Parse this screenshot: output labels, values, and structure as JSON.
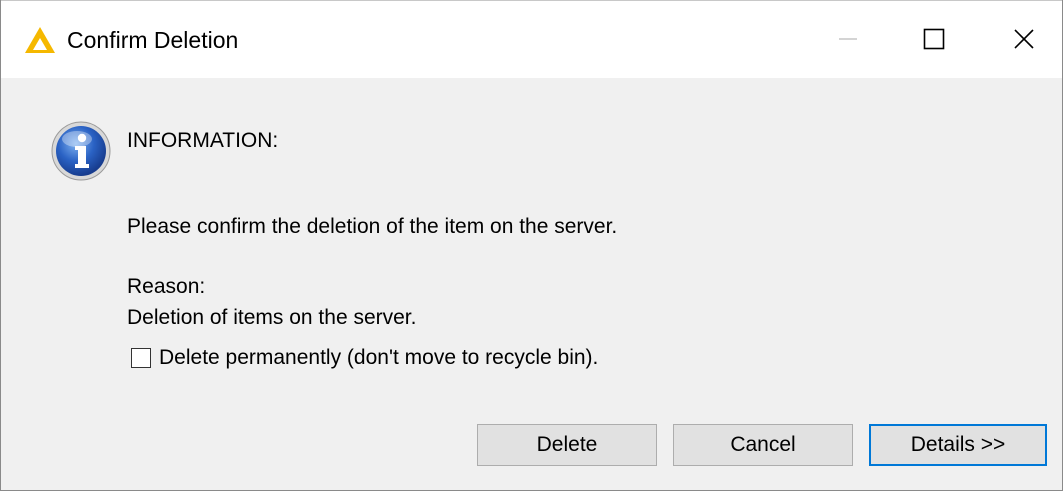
{
  "window": {
    "title": "Confirm Deletion",
    "app_icon": "triangle-logo-icon",
    "accent_color": "#f5b800",
    "controls": {
      "minimize": "minimize-icon",
      "maximize": "maximize-icon",
      "close": "close-icon"
    }
  },
  "dialog": {
    "icon": "information-icon",
    "heading": "INFORMATION:",
    "message": "Please confirm the deletion of the item on the server.",
    "reason_label": "Reason:",
    "reason_text": "Deletion of items on the server.",
    "checkbox": {
      "label": "Delete permanently (don't move to recycle bin).",
      "checked": false
    },
    "buttons": {
      "delete": "Delete",
      "cancel": "Cancel",
      "details": "Details >>"
    },
    "default_button_color": "#0078d7"
  }
}
